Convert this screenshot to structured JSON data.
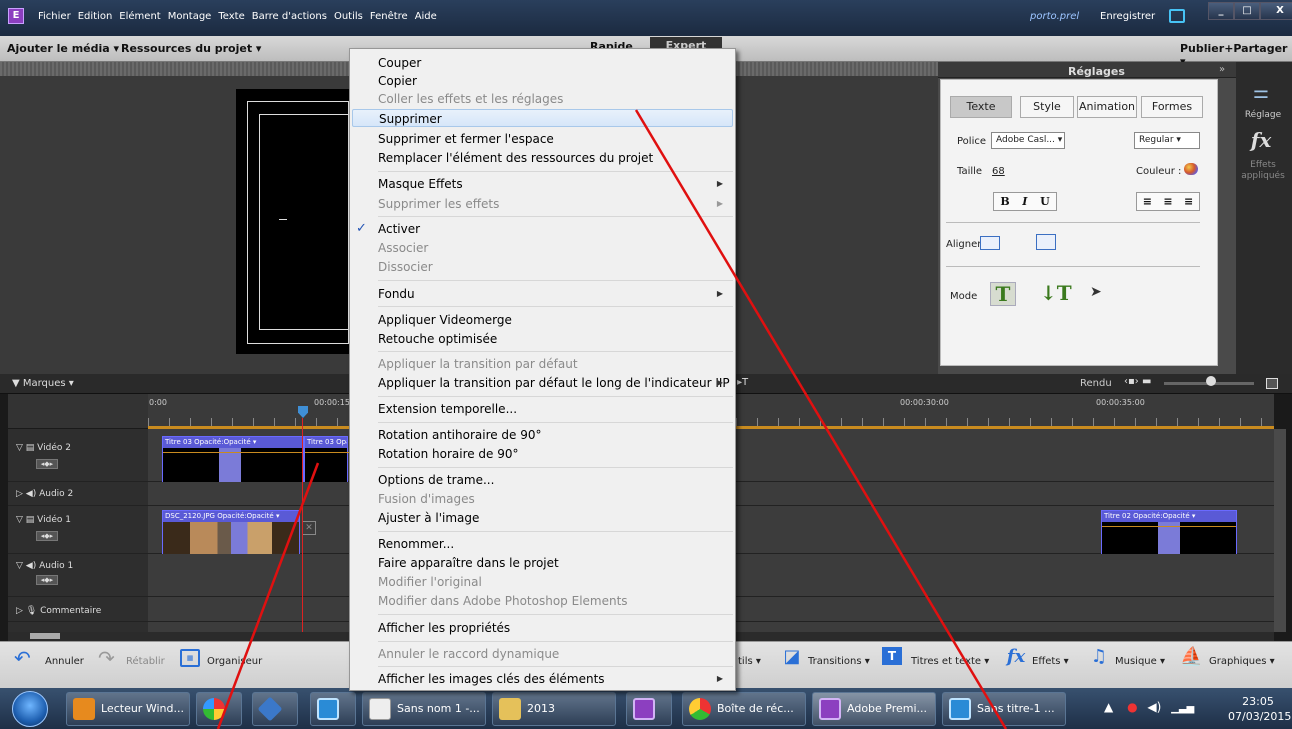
{
  "titlebar": {
    "menu": [
      "Fichier",
      "Edition",
      "Elément",
      "Montage",
      "Texte",
      "Barre d'actions",
      "Outils",
      "Fenêtre",
      "Aide"
    ],
    "project_name": "porto.prel",
    "save_label": "Enregistrer",
    "window_buttons": [
      "_",
      "□",
      "X"
    ]
  },
  "actionbar": {
    "add_media": "Ajouter le média ▾",
    "project_resources": "Ressources du projet ▾",
    "mode_quick": "Rapide",
    "mode_expert": "Expert",
    "publish": "Publier+Partager ▾"
  },
  "reglages": {
    "title": "Réglages",
    "collapse": "»",
    "tabs": [
      "Texte",
      "Style",
      "Animation",
      "Formes"
    ],
    "active_tab": "Texte",
    "font_label": "Police",
    "font_value": "Adobe Casl... ▾",
    "style_value": "Regular ▾",
    "size_label": "Taille",
    "size_value": "68",
    "color_label": "Couleur :",
    "format_buttons": [
      "B",
      "I",
      "U"
    ],
    "align_buttons": [
      "≡",
      "≡",
      "≡"
    ],
    "align_label": "Aligner",
    "mode_label": "Mode"
  },
  "toolcolumn": {
    "reglage_label": "Réglage",
    "fx_label": "fx",
    "effects_applied": "Effets appliqués"
  },
  "timeline": {
    "markers_label": "▼ Marques ▾",
    "render_label": "Rendu",
    "ruler_times": [
      "0:00",
      "00:00:15",
      "00:00:30:00",
      "00:00:35:00"
    ],
    "tracks": [
      {
        "name": "Vidéo 2"
      },
      {
        "name": "Audio 2"
      },
      {
        "name": "Vidéo 1"
      },
      {
        "name": "Audio 1"
      },
      {
        "name": "Commentaire"
      }
    ],
    "clips": {
      "v2_a": "Titre 03  Opacité:Opacité ▾",
      "v2_b": "Titre 03  Opac",
      "v1_a": "DSC_2120.JPG  Opacité:Opacité ▾",
      "v1_b": "Titre 02  Opacité:Opacité ▾"
    }
  },
  "toolbar": {
    "undo": "Annuler",
    "redo": "Rétablir",
    "organizer": "Organiseur",
    "tools": "tils ▾",
    "transitions": "Transitions ▾",
    "titles": "Titres et texte ▾",
    "effects": "Effets ▾",
    "music": "Musique ▾",
    "graphics": "Graphiques ▾"
  },
  "taskbar": {
    "items": [
      "Lecteur Wind...",
      "Sans nom 1 -...",
      "2013",
      "Boîte de réc...",
      "Adobe Premi...",
      "Sans titre-1 ..."
    ],
    "time": "23:05",
    "date": "07/03/2015"
  },
  "context_menu": {
    "items": [
      {
        "label": "Couper"
      },
      {
        "label": "Copier"
      },
      {
        "label": "Coller les effets et les réglages"
      },
      {
        "label": "Supprimer"
      },
      {
        "label": "Supprimer et fermer l'espace"
      },
      {
        "label": "Remplacer l'élément des ressources du projet"
      },
      {
        "label": "Masque Effets"
      },
      {
        "label": "Supprimer les effets"
      },
      {
        "label": "Activer"
      },
      {
        "label": "Associer"
      },
      {
        "label": "Dissocier"
      },
      {
        "label": "Fondu"
      },
      {
        "label": "Appliquer Videomerge"
      },
      {
        "label": "Retouche optimisée"
      },
      {
        "label": "Appliquer la transition par défaut"
      },
      {
        "label": "Appliquer la transition par défaut le long de l'indicateur IIP"
      },
      {
        "label": "Extension temporelle..."
      },
      {
        "label": "Rotation antihoraire de 90°"
      },
      {
        "label": "Rotation horaire de 90°"
      },
      {
        "label": "Options de trame..."
      },
      {
        "label": "Fusion d'images"
      },
      {
        "label": "Ajuster à l'image"
      },
      {
        "label": "Renommer..."
      },
      {
        "label": "Faire apparaître dans le projet"
      },
      {
        "label": "Modifier l'original"
      },
      {
        "label": "Modifier dans Adobe Photoshop Elements"
      },
      {
        "label": "Afficher les propriétés"
      },
      {
        "label": "Annuler le raccord dynamique"
      },
      {
        "label": "Afficher les images clés des éléments"
      }
    ]
  },
  "colors": {
    "accent": "#2455b5",
    "annotation": "#e01010",
    "clip": "#5a5ad6"
  }
}
